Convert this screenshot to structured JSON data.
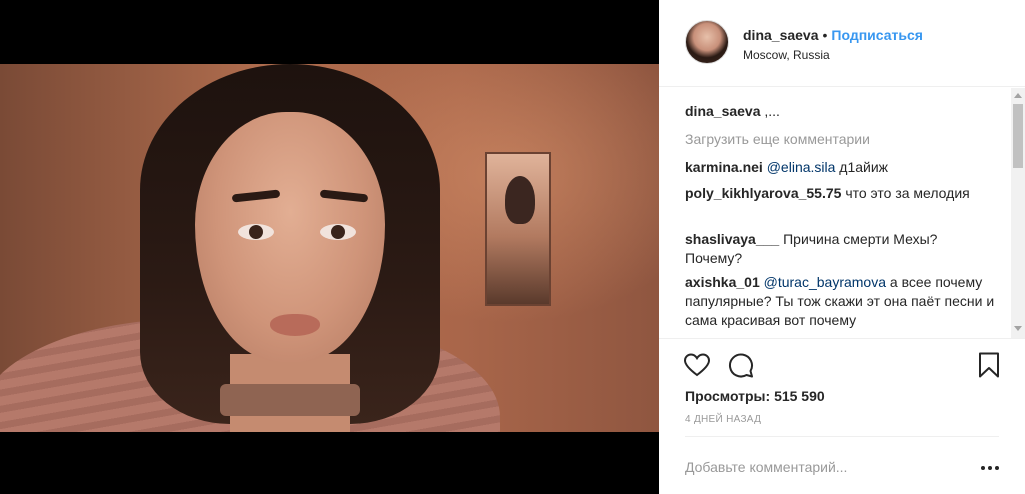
{
  "post": {
    "username": "dina_saeva",
    "separator": "•",
    "follow_label": "Подписаться",
    "location": "Moscow, Russia"
  },
  "caption": {
    "author": "dina_saeva",
    "text": ",..."
  },
  "load_more_label": "Загрузить еще комментарии",
  "comments": [
    {
      "author": "karmina.nei",
      "mention": "@elina.sila",
      "text": "д1айиж"
    },
    {
      "author": "poly_kikhlyarova_55.75",
      "mention": "",
      "text": "что это за мелодия"
    },
    {
      "author": "shaslivaya___",
      "mention": "",
      "text": "Причина смерти Мехы? Почему?"
    },
    {
      "author": "axishka_01",
      "mention": "@turac_bayramova",
      "text": "а всее почему папулярные? Ты тож скажи эт она паёт песни и сама красивая вот почему"
    }
  ],
  "actions": {
    "like_icon": "heart-icon",
    "comment_icon": "comment-icon",
    "save_icon": "bookmark-icon"
  },
  "views": {
    "label": "Просмотры:",
    "count": "515 590"
  },
  "timestamp": "4 ДНЕЙ НАЗАД",
  "add_comment": {
    "placeholder": "Добавьте комментарий..."
  },
  "colors": {
    "link": "#3897f0",
    "mention": "#003569",
    "muted": "#999999",
    "text": "#262626"
  }
}
